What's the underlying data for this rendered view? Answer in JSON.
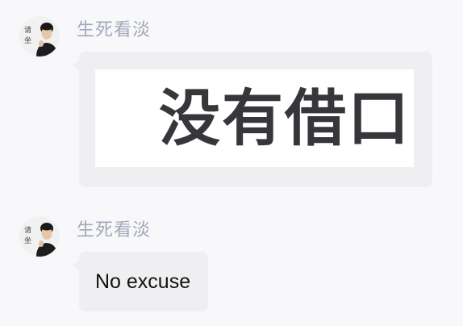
{
  "messages": [
    {
      "sender": "生死看淡",
      "avatar_text": [
        "请",
        "坐"
      ],
      "type": "sticker",
      "sticker_text": "没有借口"
    },
    {
      "sender": "生死看淡",
      "avatar_text": [
        "请",
        "坐"
      ],
      "type": "text",
      "text": "No excuse"
    }
  ],
  "colors": {
    "background": "#f8f8fa",
    "bubble": "#efeff1",
    "sender_name": "#a0a8b8",
    "text": "#111111",
    "sticker_text": "#37373b"
  }
}
